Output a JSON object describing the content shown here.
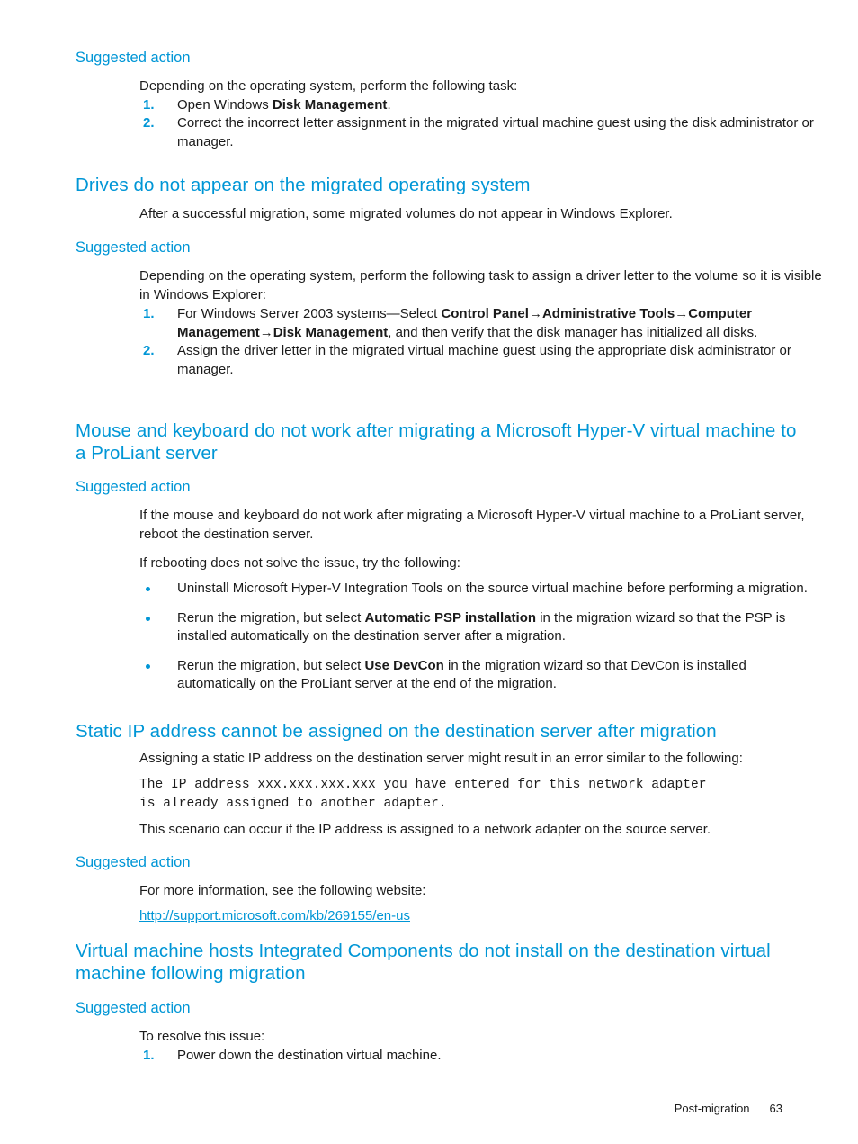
{
  "document": {
    "footer": {
      "section_label": "Post-migration",
      "page_number": "63"
    },
    "colors": {
      "heading_blue": "#0096d6",
      "body_text": "#1c1c1c",
      "link_blue": "#0096d6"
    }
  },
  "sections": {
    "suggested_action_label": "Suggested action",
    "top_block": {
      "intro": "Depending on the operating system, perform the following task:",
      "step1_prefix": "Open Windows ",
      "step1_bold": "Disk Management",
      "step1_suffix": ".",
      "step1_number": "1.",
      "step2_number": "2.",
      "step2": "Correct the incorrect letter assignment in the migrated virtual machine guest using the disk administrator or manager."
    },
    "drives": {
      "heading": "Drives do not appear on the migrated operating system",
      "intro": "After a successful migration, some migrated volumes do not appear in Windows Explorer.",
      "suggested_intro": "Depending on the operating system, perform the following task to assign a driver letter to the volume so it is visible in Windows Explorer:",
      "step1_number": "1.",
      "step1_a": "For Windows Server 2003 systems—Select ",
      "step1_b1": "Control Panel",
      "step1_arrow1": "→",
      "step1_b2": "Administrative Tools",
      "step1_arrow2": "→",
      "step1_b3": "Computer Management",
      "step1_arrow3": "→",
      "step1_b4": "Disk Management",
      "step1_c": ", and then verify that the disk manager has initialized all disks.",
      "step2_number": "2.",
      "step2": "Assign the driver letter in the migrated virtual machine guest using the appropriate disk administrator or manager."
    },
    "mouse_keyboard": {
      "heading": "Mouse and keyboard do not work after migrating a Microsoft Hyper-V virtual machine to a ProLiant server",
      "para1": "If the mouse and keyboard do not work after migrating a Microsoft Hyper-V virtual machine to a ProLiant server, reboot the destination server.",
      "para2": "If rebooting does not solve the issue, try the following:",
      "bullet1": "Uninstall Microsoft Hyper-V Integration Tools on the source virtual machine before performing a migration.",
      "bullet2_a": "Rerun the migration, but select ",
      "bullet2_bold": "Automatic PSP installation",
      "bullet2_b": " in the migration wizard so that the PSP is installed automatically on the destination server after a migration.",
      "bullet3_a": "Rerun the migration, but select ",
      "bullet3_bold": "Use DevCon",
      "bullet3_b": " in the migration wizard so that DevCon is installed automatically on the ProLiant server at the end of the migration."
    },
    "static_ip": {
      "heading": "Static IP address cannot be assigned on the destination server after migration",
      "para1": "Assigning a static IP address on the destination server might result in an error similar to the following:",
      "code_line1": "The IP address xxx.xxx.xxx.xxx you have entered for this network adapter",
      "code_line2": "is already assigned to another adapter.",
      "para2": "This scenario can occur if the IP address is assigned to a network adapter on the source server.",
      "suggested_para": "For more information, see the following website:",
      "link_text": "http://support.microsoft.com/kb/269155/en-us"
    },
    "integrated_components": {
      "heading": "Virtual machine hosts Integrated Components do not install on the destination virtual machine following migration",
      "intro": "To resolve this issue:",
      "step1_number": "1.",
      "step1": "Power down the destination virtual machine."
    }
  }
}
